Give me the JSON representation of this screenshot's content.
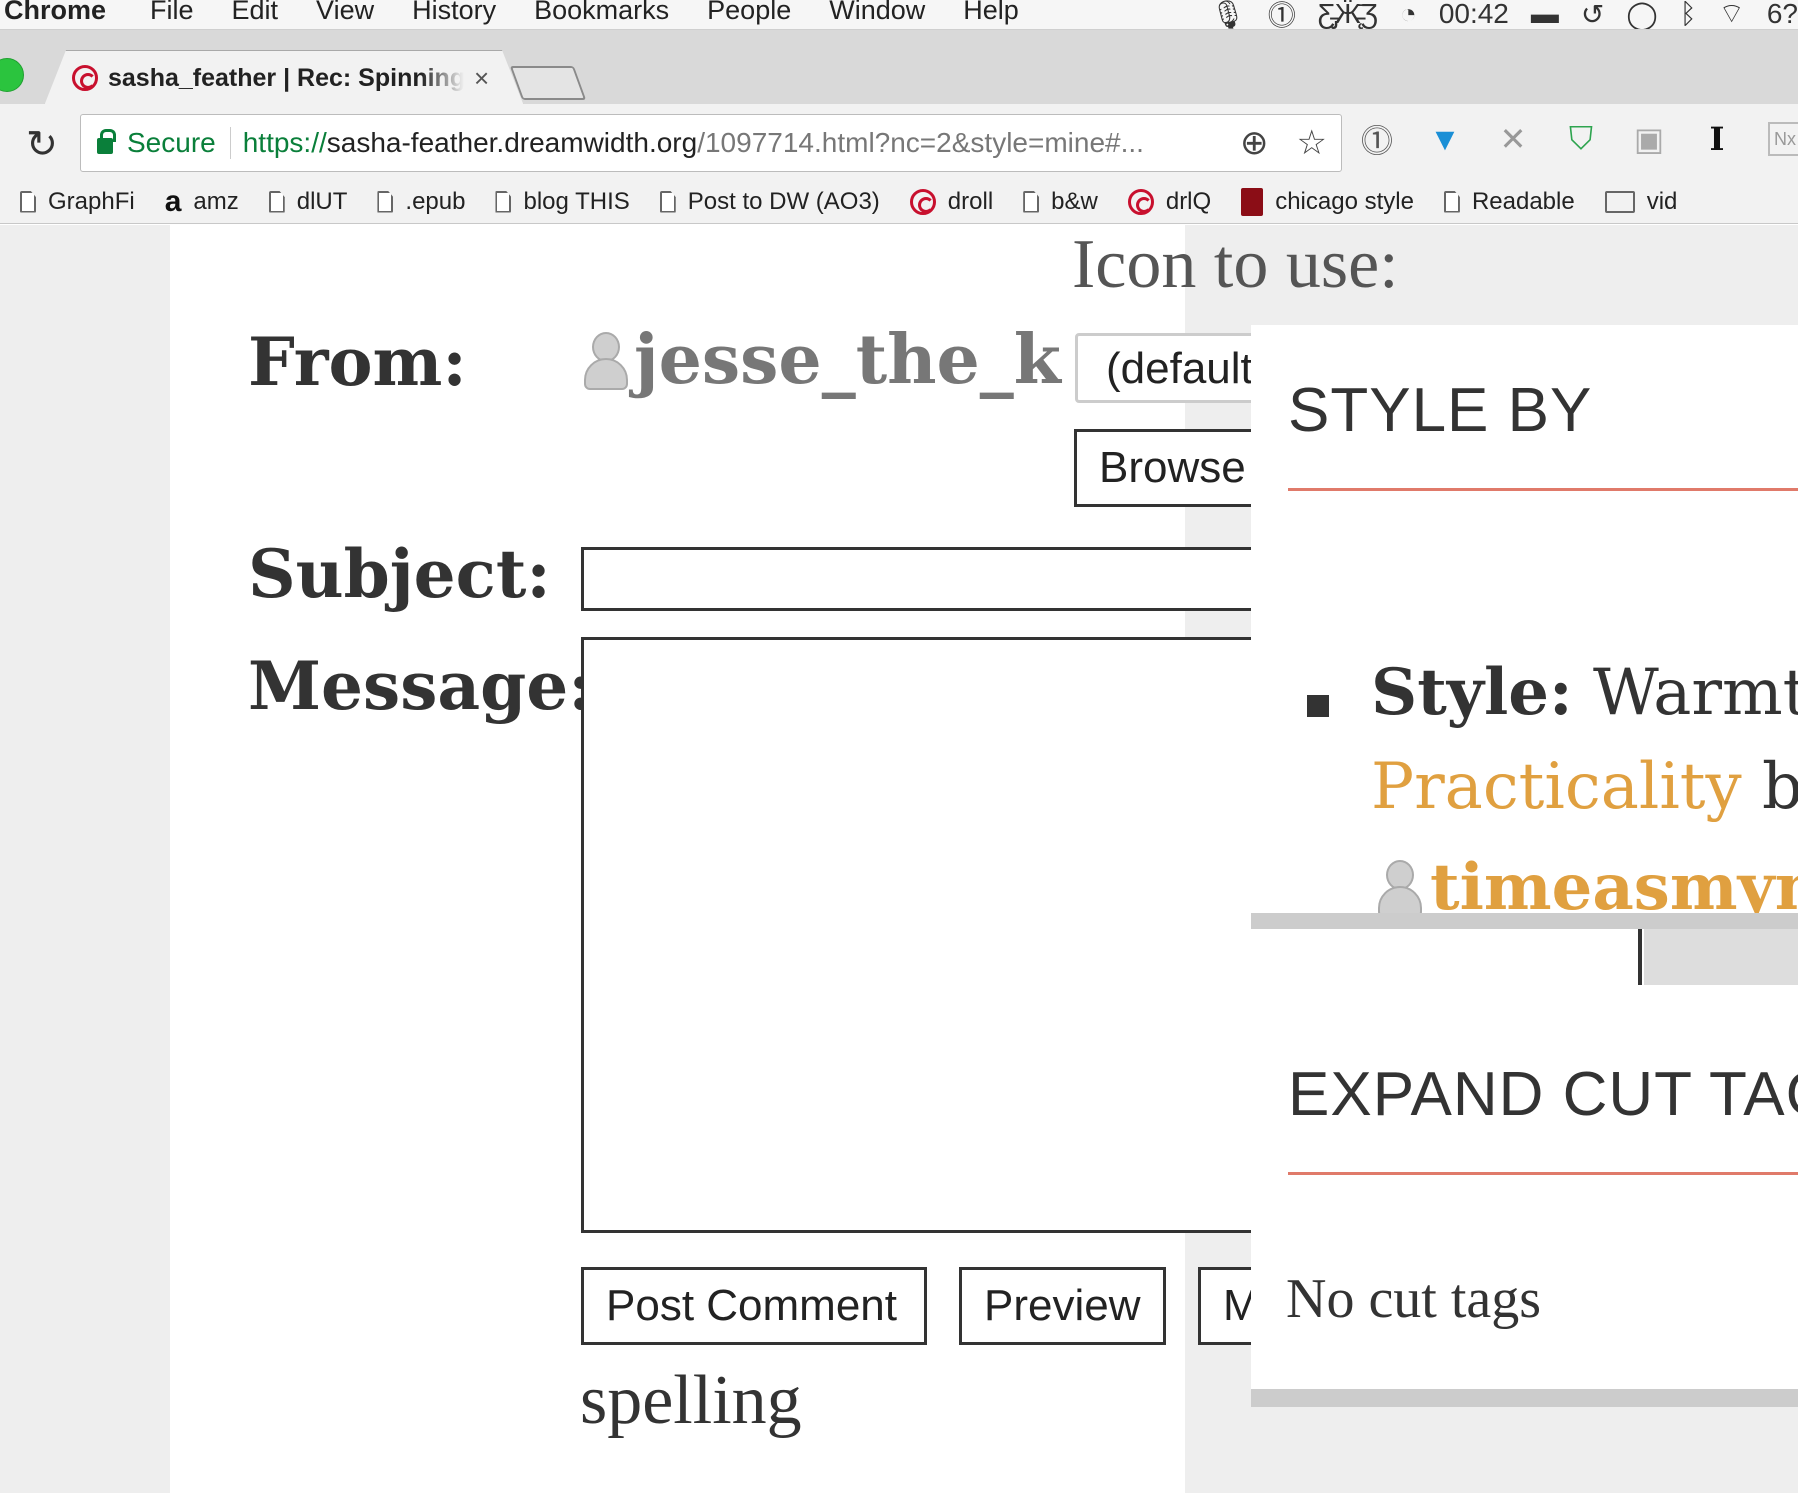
{
  "menubar": {
    "app_name": "Chrome",
    "menus": [
      "File",
      "Edit",
      "View",
      "History",
      "Bookmarks",
      "People",
      "Window",
      "Help"
    ],
    "clock": "00:42",
    "battery_partial": "6?"
  },
  "tab": {
    "title": "sasha_feather | Rec: Spinning",
    "close": "×"
  },
  "omnibox": {
    "secure_label": "Secure",
    "url_scheme": "https://",
    "url_host": "sasha-feather.dreamwidth.org",
    "url_rest": "/1097714.html?nc=2&style=mine#..."
  },
  "bookmarks": [
    {
      "label": "GraphFi",
      "icon": "doc-icon"
    },
    {
      "label": "amz",
      "icon": "amazon-icon"
    },
    {
      "label": "dlUT",
      "icon": "doc-icon"
    },
    {
      "label": ".epub",
      "icon": "doc-icon"
    },
    {
      "label": "blog THIS",
      "icon": "doc-icon"
    },
    {
      "label": "Post to DW (AO3)",
      "icon": "doc-icon"
    },
    {
      "label": "droll",
      "icon": "dreamwidth-icon"
    },
    {
      "label": "b&w",
      "icon": "doc-icon"
    },
    {
      "label": "drlQ",
      "icon": "dreamwidth-icon"
    },
    {
      "label": "chicago style",
      "icon": "book-icon"
    },
    {
      "label": "Readable",
      "icon": "doc-icon"
    },
    {
      "label": "vid",
      "icon": "folder-icon"
    }
  ],
  "form": {
    "icon_to_use_label": "Icon to use:",
    "from_label": "From:",
    "username": "jesse_the_k",
    "icon_select_value": "(default)",
    "browse_label": "Browse",
    "subject_label": "Subject:",
    "subject_value": "",
    "message_label": "Message:",
    "message_value": "",
    "post_comment_label": "Post Comment",
    "preview_label": "Preview",
    "more_options_partial": "M",
    "spelling_text": "spelling"
  },
  "sidebar": {
    "style_by_heading": "STYLE BY",
    "style_prefix": "Style:",
    "style_name_part1": "Warmth",
    "style_name_part2": "Practicality",
    "style_by_word": "by",
    "style_author": "timeasmymeasure",
    "expand_cut_heading": "EXPAND CUT TAGS",
    "no_cut_tags": "No cut tags"
  },
  "colors": {
    "secure_green": "#0a7f3a",
    "dreamwidth_red": "#c8102e",
    "section_rule": "#e07a6a",
    "link_orange": "#e0a040"
  }
}
